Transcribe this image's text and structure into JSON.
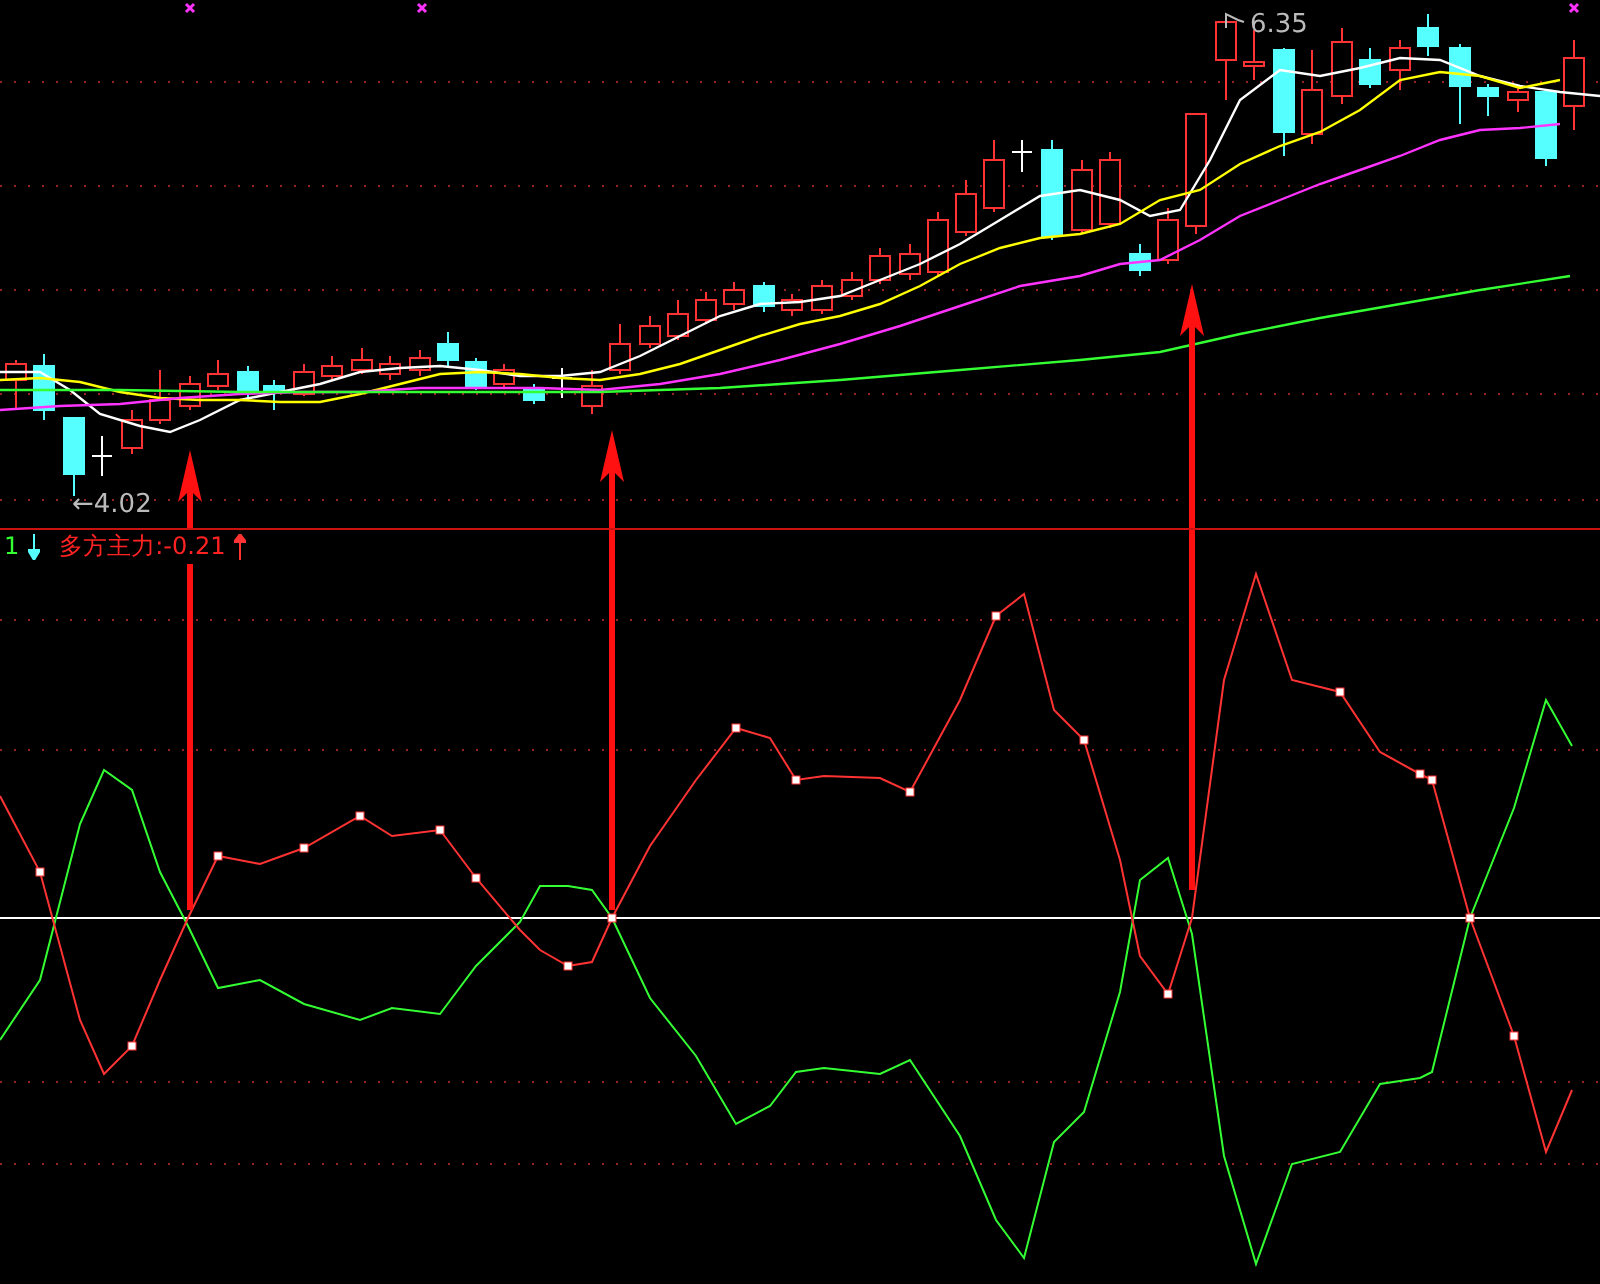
{
  "price_panel": {
    "high_label": "6.35",
    "low_label": "←4.02"
  },
  "indicator_panel": {
    "index": "1",
    "title": "多方主力:-0.21"
  }
}
